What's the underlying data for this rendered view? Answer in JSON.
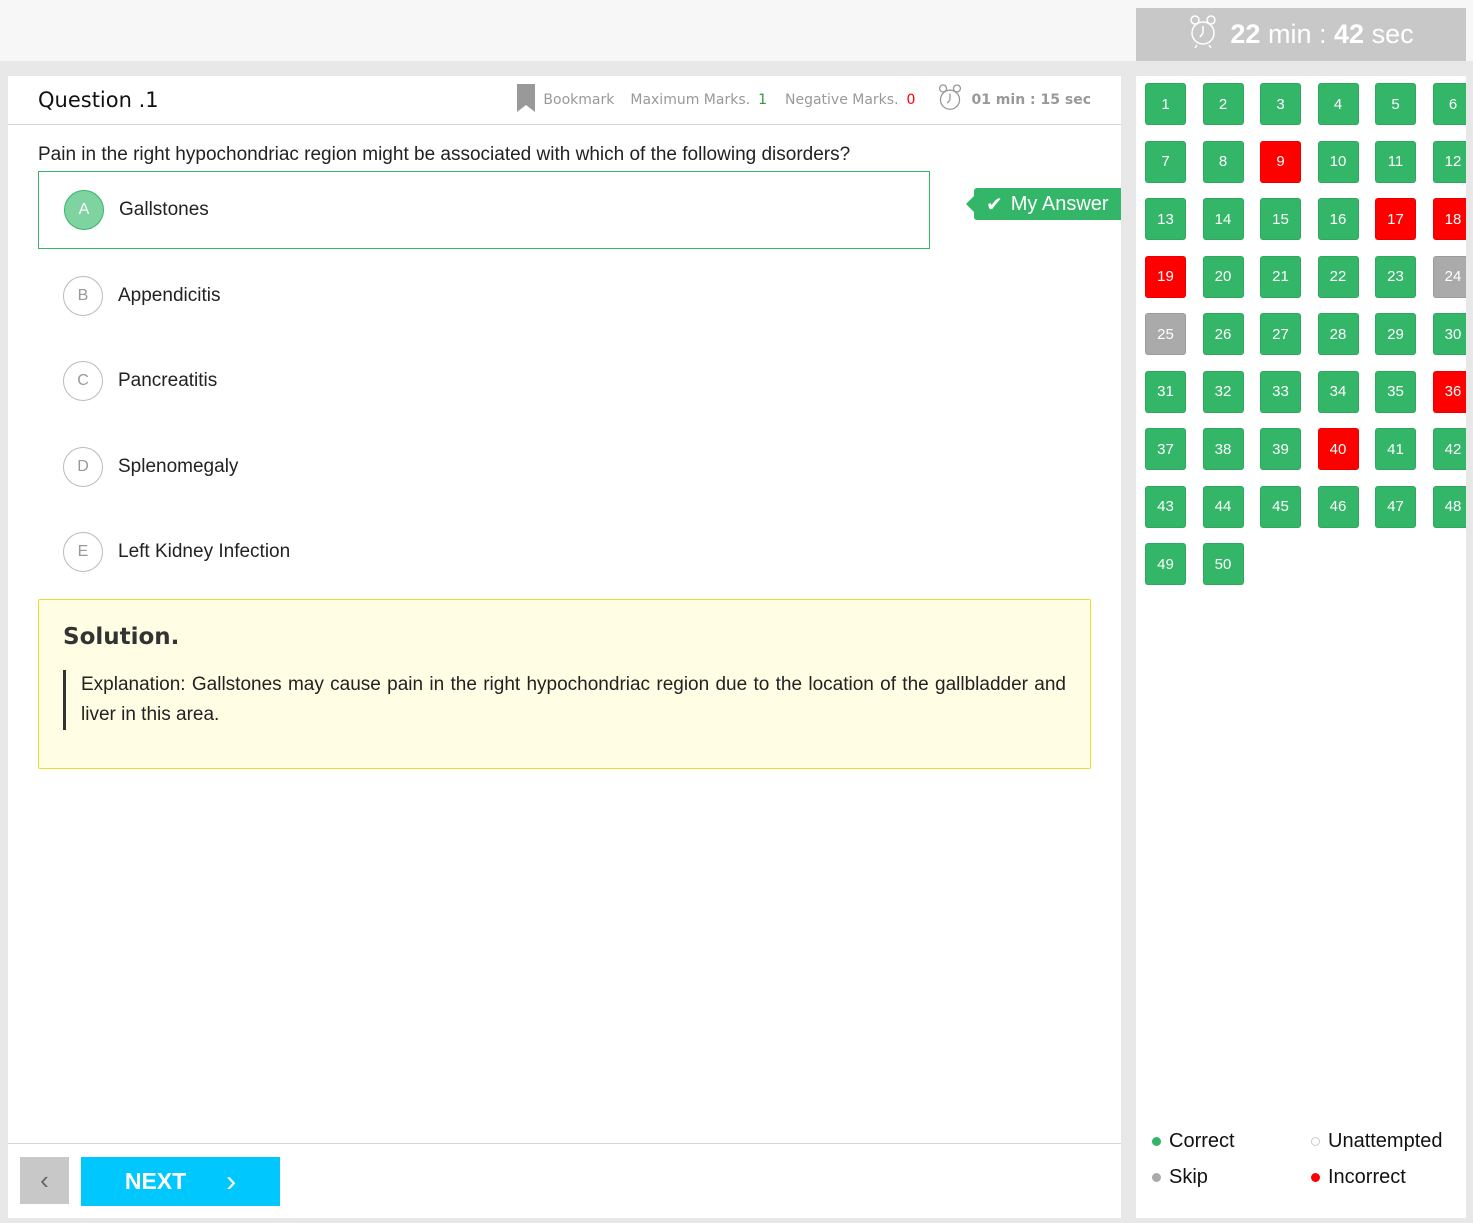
{
  "timer": {
    "minutes": "22",
    "min_label": "min :",
    "seconds": "42",
    "sec_label": "sec"
  },
  "question": {
    "title": "Question .1",
    "bookmark": "Bookmark",
    "max_marks_label": "Maximum Marks.",
    "max_marks": "1",
    "neg_marks_label": "Negative Marks.",
    "neg_marks": "0",
    "time": "01 min : 15 sec",
    "text": "Pain in the right hypochondriac region might be associated with which of the following disorders?",
    "options": [
      {
        "letter": "A",
        "text": "Gallstones",
        "selected": true
      },
      {
        "letter": "B",
        "text": "Appendicitis"
      },
      {
        "letter": "C",
        "text": "Pancreatitis"
      },
      {
        "letter": "D",
        "text": "Splenomegaly"
      },
      {
        "letter": "E",
        "text": "Left Kidney Infection"
      }
    ],
    "my_answer": "My Answer"
  },
  "solution": {
    "title": "Solution.",
    "text": "Explanation: Gallstones may cause pain in the right hypochondriac region due to the location of the gallbladder and liver in this area."
  },
  "footer": {
    "next": "NEXT"
  },
  "colors": {
    "correct": "#33b668",
    "incorrect": "#ff0000",
    "skip": "#aaaaaa"
  },
  "palette": {
    "incorrect": [
      9,
      17,
      18,
      19,
      36,
      40
    ],
    "skip": [
      24,
      25
    ],
    "total": 50
  },
  "legend": {
    "correct": "Correct",
    "unattempted": "Unattempted",
    "skip": "Skip",
    "incorrect": "Incorrect"
  }
}
